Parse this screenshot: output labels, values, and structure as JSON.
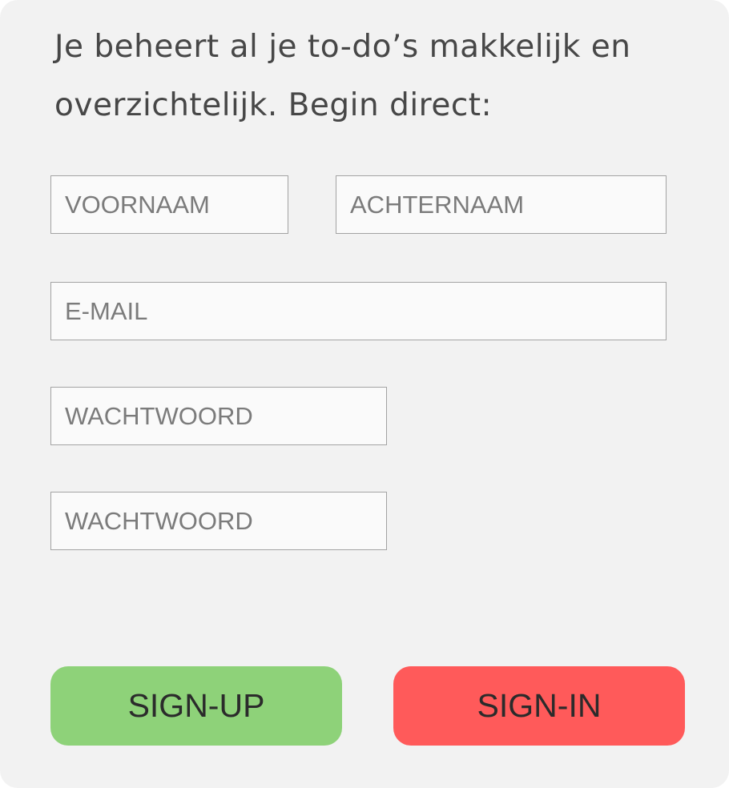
{
  "form": {
    "headline": "Je beheert al je to-do’s makkelijk en overzichtelijk. Begin direct:",
    "first_name_placeholder": "VOORNAAM",
    "last_name_placeholder": "ACHTERNAAM",
    "email_placeholder": "E-MAIL",
    "password_placeholder": "WACHTWOORD",
    "password_confirm_placeholder": "WACHTWOORD"
  },
  "actions": {
    "signup_label": "SIGN-UP",
    "signin_label": "SIGN-IN"
  },
  "colors": {
    "card_background": "#f2f2f2",
    "signup_button": "#8ed279",
    "signin_button": "#ff5a5a"
  }
}
